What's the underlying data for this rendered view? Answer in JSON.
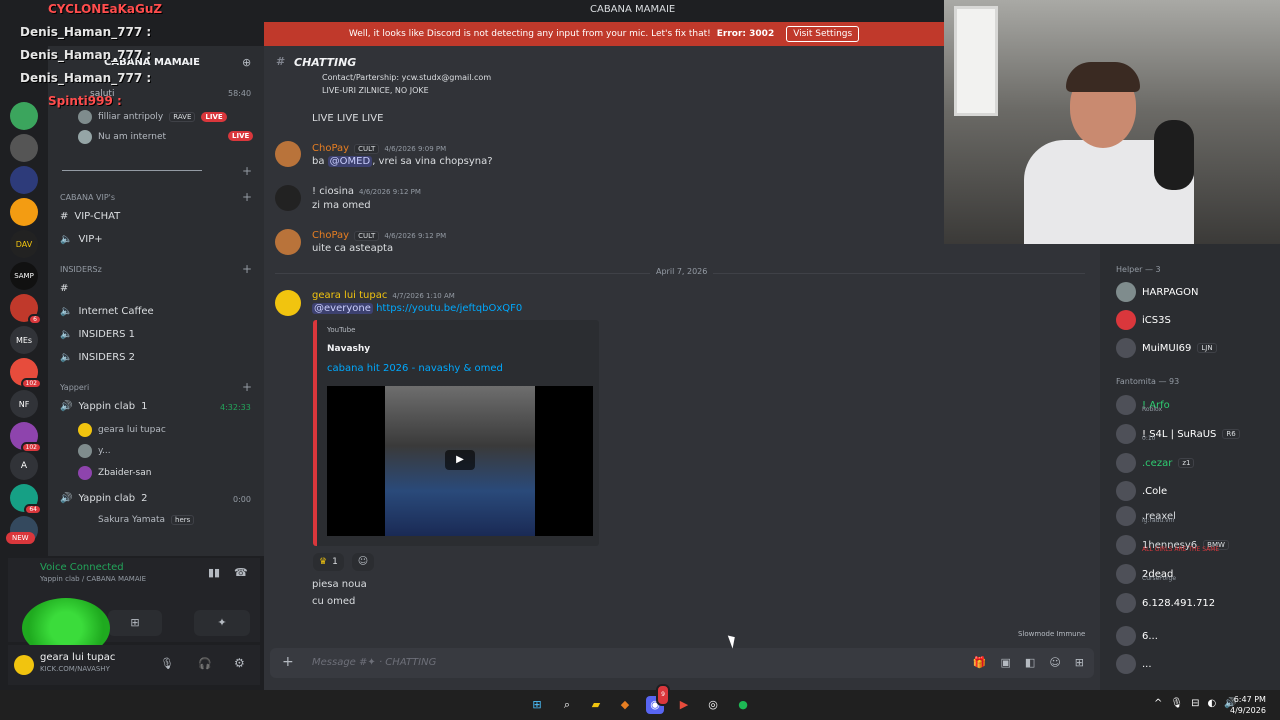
{
  "window": {
    "title": "CABANA MAMAIE"
  },
  "banner": {
    "text": "Well, it looks like Discord is not detecting any input from your mic. Let's fix that!",
    "error": "Error: 3002",
    "button": "Visit Settings"
  },
  "overlay": {
    "names": [
      "CYCLONEaKaGuZ",
      "Denis_Haman_777 :",
      "Denis_Haman_777 :",
      "Denis_Haman_777 :",
      "Spinti999 :"
    ]
  },
  "servers": {
    "badges": [
      "6",
      "102",
      "64",
      "102"
    ],
    "labels": [
      "DAV",
      "SAMP",
      "MEs",
      "NF",
      "A"
    ],
    "new_label": "NEW"
  },
  "sidebar": {
    "server_name": "CABANA MAMAIE",
    "voice_time": "58:40",
    "top_users": [
      {
        "name": "saluti"
      },
      {
        "name": "filliar antripoly",
        "tag": "RAVE",
        "live": "LIVE"
      },
      {
        "name": "Nu am internet",
        "live": "LIVE"
      }
    ],
    "cat_vip": "CABANA VIP's",
    "vip_chat": "VIP-CHAT",
    "vip_plus": "VIP+",
    "cat_insiders": "INSIDERSz",
    "ch_internet": "Internet Caffee",
    "ch_insiders1": "INSIDERS 1",
    "ch_insiders2": "INSIDERS 2",
    "cat_yapperi": "Yapperi",
    "yappin1": {
      "name": "Yappin clab",
      "count": "1",
      "time": "4:32:33"
    },
    "yappin1_users": [
      "geara lui tupac",
      "y...",
      "Zbaider-san"
    ],
    "yappin2": {
      "name": "Yappin clab",
      "count": "2",
      "time": "0:00"
    },
    "yappin2_users": [
      "Sakura Yamata",
      "hers"
    ]
  },
  "voice_panel": {
    "status": "Voice Connected",
    "channel": "Yappin clab / CABANA MAMAIE"
  },
  "user_panel": {
    "name": "geara lui tupac",
    "status": "KICK.COM/NAVASHY"
  },
  "chat": {
    "channel_name": "CHATTING",
    "top_lines": [
      "Contact/Partership: ycw.studx@gmail.com",
      "LIVE-URI ZILNICE, NO JOKE"
    ],
    "live_line": "LIVE LIVE LIVE",
    "messages": [
      {
        "author": "ChoPay",
        "tag": "CULT",
        "ts": "4/6/2026 9:09 PM",
        "pre": "ba ",
        "mention": "@OMED",
        "post": ", vrei sa vina chopsyna?"
      },
      {
        "author": "! ciosina",
        "ts": "4/6/2026 9:12 PM",
        "text": "zi ma omed"
      },
      {
        "author": "ChoPay",
        "tag": "CULT",
        "ts": "4/6/2026 9:12 PM",
        "text": "uite ca asteapta"
      }
    ],
    "date_sep": "April 7, 2026",
    "post": {
      "author": "geara lui tupac",
      "ts": "4/7/2026 1:10 AM",
      "mention": "@everyone",
      "link": "https://youtu.be/jeftqbOxQF0",
      "embed": {
        "provider": "YouTube",
        "author": "Navashy",
        "title": "cabana hit 2026 - navashy & omed"
      },
      "reaction_count": "1",
      "lines": [
        "piesa noua",
        "cu omed"
      ]
    },
    "slowmode": "Slowmode Immune",
    "placeholder": "Message #✦ · CHATTING"
  },
  "members": {
    "cat_helper": "Helper — 3",
    "helpers": [
      {
        "name": "HARPAGON"
      },
      {
        "name": "iCS3S"
      },
      {
        "name": "MuiMUI69",
        "tag": "LJN"
      }
    ],
    "cat_fantomita": "Fantomita — 93",
    "list": [
      {
        "name": "! Arfo",
        "sub": "Roblox"
      },
      {
        "name": "! S4L | SuRaUS",
        "tag": "R6",
        "sub": "0:10"
      },
      {
        "name": ".cezar",
        "tag": "z1"
      },
      {
        "name": ".Cole"
      },
      {
        "name": ".reaxel",
        "sub": "ig:radu.vnr"
      },
      {
        "name": "1hennesy6",
        "tag": "BMW",
        "sub": "ALL GIRLS ARE THE SAME"
      },
      {
        "name": "2dead",
        "sub": "CurseForge"
      },
      {
        "name": "6.128.491.712"
      },
      {
        "name": "6..."
      },
      {
        "name": "..."
      }
    ]
  },
  "taskbar": {
    "time": "6:47 PM",
    "date": "4/9/2026",
    "discord_badge": "9"
  },
  "colors": {
    "accent": "#5865f2",
    "banner": "#c0392b",
    "online": "#23a55a",
    "link": "#00a8fc",
    "chopay": "#e67e22",
    "helper": "#ffffff",
    "fantomita": "#2ecc71"
  }
}
